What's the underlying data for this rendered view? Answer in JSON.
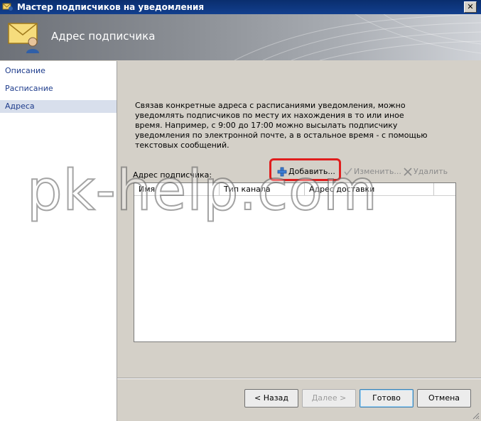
{
  "window": {
    "title": "Мастер подписчиков на уведомления",
    "close_label": "✕"
  },
  "banner": {
    "title": "Адрес подписчика"
  },
  "sidebar": {
    "items": [
      {
        "label": "Описание",
        "active": false
      },
      {
        "label": "Расписание",
        "active": false
      },
      {
        "label": "Адреса",
        "active": true
      }
    ]
  },
  "main": {
    "description": "Связав конкретные адреса с расписаниями уведомления, можно уведомлять подписчиков по месту их нахождения в то или иное время. Например, с 9:00 до 17:00 можно высылать подписчику уведомления по электронной почте, а в остальное время - с помощью текстовых сообщений.",
    "address_label": "Адрес подписчика:",
    "toolbar": {
      "add": "Добавить...",
      "edit": "Изменить...",
      "delete": "Удалить"
    },
    "table": {
      "columns": [
        "Имя",
        "Тип канала",
        "Адрес доставки"
      ],
      "rows": []
    }
  },
  "footer": {
    "back": "< Назад",
    "next": "Далее >",
    "finish": "Готово",
    "cancel": "Отмена"
  },
  "watermark": "pk-help.com"
}
